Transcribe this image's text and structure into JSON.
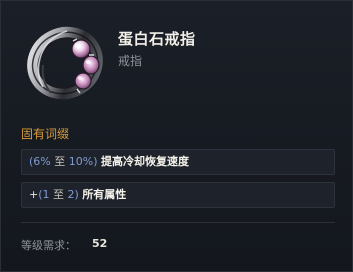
{
  "item": {
    "name": "蛋白石戒指",
    "type": "戒指",
    "icon": "opal-ring-icon"
  },
  "affixes": {
    "section_title": "固有词缀",
    "affix_1": {
      "open": "(",
      "min": "6%",
      "to": "至",
      "max": "10%",
      "close": ")",
      "stat": "提高冷却恢复速度"
    },
    "affix_2": {
      "plus": "+",
      "open": "(",
      "min": "1",
      "to": "至",
      "max": "2",
      "close": ")",
      "stat": "所有属性"
    }
  },
  "requirement": {
    "label": "等级需求：",
    "value": "52"
  },
  "colors": {
    "section_title": "#d89b3a",
    "range_value": "#7f9ad4",
    "item_name": "#f2efe8",
    "muted": "#8d939c"
  }
}
